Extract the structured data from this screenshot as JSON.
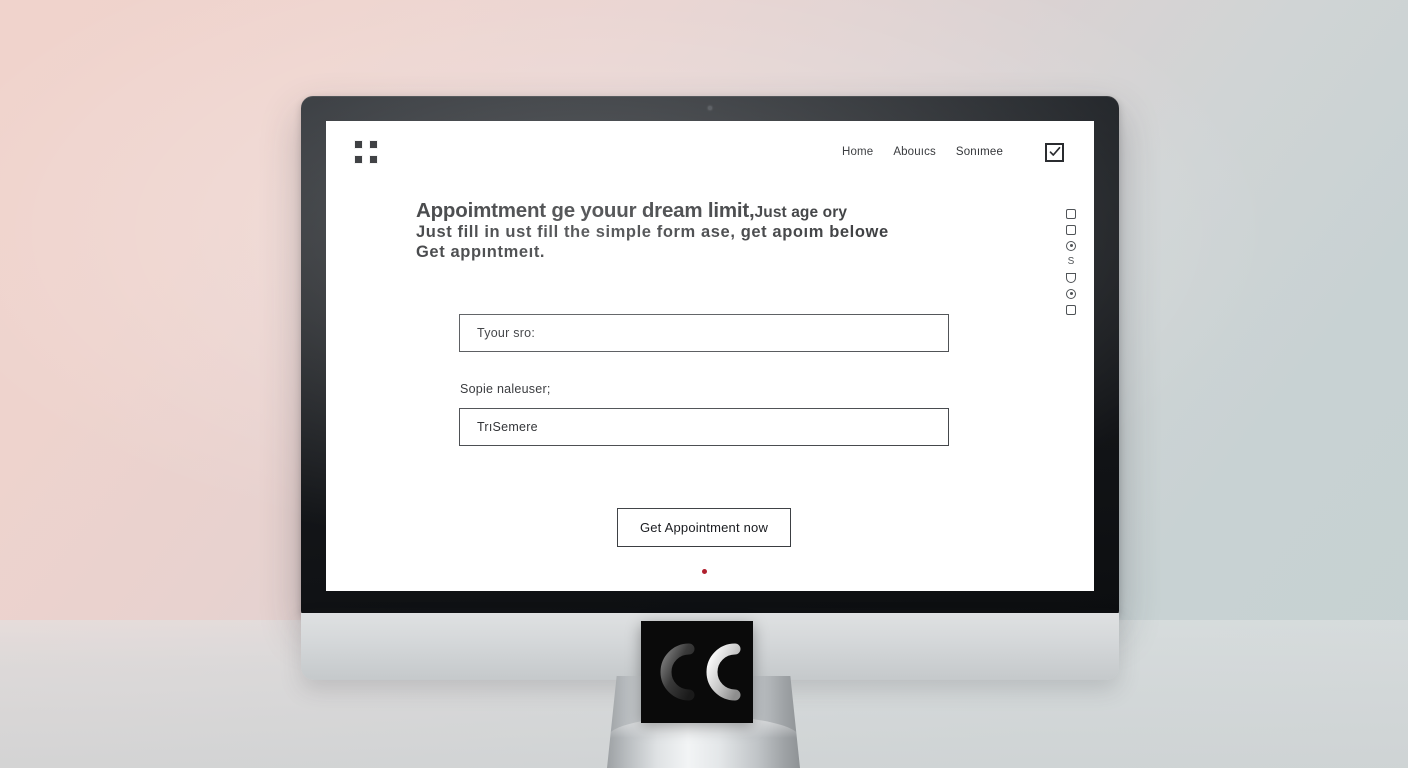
{
  "scene": {
    "background_top_left": "#efd2cc",
    "background_bottom_right": "#c7d2d3",
    "device": "desktop-monitor",
    "stand_logo_text": "CC"
  },
  "site": {
    "logo": {
      "name": "grid-logo",
      "icon": "four-square-grid-icon",
      "squares": 4
    },
    "nav": {
      "items": [
        {
          "label": "Home"
        },
        {
          "label": "Abouıcs"
        },
        {
          "label": "Sonımee"
        }
      ],
      "action_icon": {
        "name": "checkbox-checked-icon",
        "icon": "check-mark"
      }
    },
    "hero": {
      "line1_bold": "Appoimtment ge youur dream limit,",
      "line1_thin": "Just age ory",
      "line2": "Just fill in ust fill the simple form ase, get apoım belowe",
      "line3": "Get appıntmeıt."
    },
    "form": {
      "fields": [
        {
          "name": "name-field",
          "value": "Tyour sro:",
          "placeholder": "Tyour sro:"
        }
      ],
      "label": "Sopie naleuser;",
      "second_field": {
        "name": "time-field",
        "value": "TrıSemere",
        "placeholder": "TrıSemere"
      }
    },
    "cta": {
      "label": "Get Appointment now",
      "dot_color": "#b01f2e"
    },
    "social_rail": [
      {
        "name": "facebook-icon",
        "shape": "rounded-square"
      },
      {
        "name": "twitter-icon",
        "shape": "rounded-square"
      },
      {
        "name": "instagram-icon",
        "shape": "circle-dot"
      },
      {
        "name": "skype-icon",
        "shape": "s-glyph",
        "glyph": "S"
      },
      {
        "name": "pinterest-icon",
        "shape": "cup"
      },
      {
        "name": "behance-icon",
        "shape": "circle-dot"
      },
      {
        "name": "linkedin-icon",
        "shape": "rounded-square"
      }
    ]
  }
}
